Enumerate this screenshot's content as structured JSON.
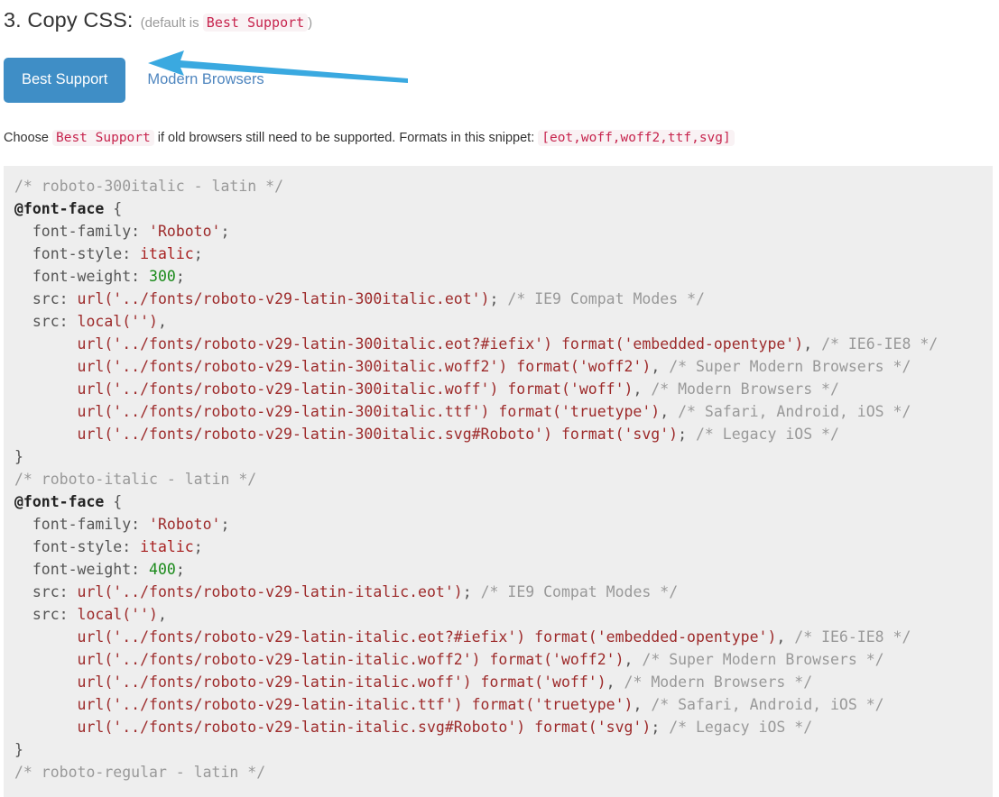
{
  "heading": {
    "title": "3. Copy CSS:",
    "note_prefix": "(default is",
    "note_code": "Best Support",
    "note_suffix": ")"
  },
  "tabs": [
    {
      "label": "Best Support",
      "active": true
    },
    {
      "label": "Modern Browsers",
      "active": false
    }
  ],
  "annotation": {
    "arrow_color": "#3aa9e0",
    "points_to": "Best Support"
  },
  "choose_line": {
    "part1": "Choose",
    "code1": "Best Support",
    "part2": "if old browsers still need to be supported. Formats in this snippet:",
    "code2": "[eot,woff,woff2,ttf,svg]"
  },
  "colors": {
    "tab_active_bg": "#3f8ec6",
    "tab_active_text": "#ffffff",
    "tab_inactive_text": "#4f86bf",
    "inline_code_text": "#c7254e",
    "inline_code_bg": "#f9f2f4",
    "code_block_bg": "#eeeeee",
    "comment": "#999999",
    "string": "#9d2a2a",
    "number": "#1a8a1a"
  },
  "code": {
    "language": "css",
    "lines": [
      [
        [
          "cm",
          "/* roboto-300italic - latin */"
        ]
      ],
      [
        [
          "at",
          "@font-face"
        ],
        [
          "pn",
          " {"
        ]
      ],
      [
        [
          "pr",
          "  font-family: "
        ],
        [
          "st",
          "'Roboto'"
        ],
        [
          "pn",
          ";"
        ]
      ],
      [
        [
          "pr",
          "  font-style: "
        ],
        [
          "kw",
          "italic"
        ],
        [
          "pn",
          ";"
        ]
      ],
      [
        [
          "pr",
          "  font-weight: "
        ],
        [
          "nm",
          "300"
        ],
        [
          "pn",
          ";"
        ]
      ],
      [
        [
          "pr",
          "  src: "
        ],
        [
          "st",
          "url('../fonts/roboto-v29-latin-300italic.eot')"
        ],
        [
          "pn",
          "; "
        ],
        [
          "cm",
          "/* IE9 Compat Modes */"
        ]
      ],
      [
        [
          "pr",
          "  src: "
        ],
        [
          "st",
          "local('')"
        ],
        [
          "pn",
          ","
        ]
      ],
      [
        [
          "st",
          "       url('../fonts/roboto-v29-latin-300italic.eot?#iefix') format('embedded-opentype')"
        ],
        [
          "pn",
          ", "
        ],
        [
          "cm",
          "/* IE6-IE8 */"
        ]
      ],
      [
        [
          "st",
          "       url('../fonts/roboto-v29-latin-300italic.woff2') format('woff2')"
        ],
        [
          "pn",
          ", "
        ],
        [
          "cm",
          "/* Super Modern Browsers */"
        ]
      ],
      [
        [
          "st",
          "       url('../fonts/roboto-v29-latin-300italic.woff') format('woff')"
        ],
        [
          "pn",
          ", "
        ],
        [
          "cm",
          "/* Modern Browsers */"
        ]
      ],
      [
        [
          "st",
          "       url('../fonts/roboto-v29-latin-300italic.ttf') format('truetype')"
        ],
        [
          "pn",
          ", "
        ],
        [
          "cm",
          "/* Safari, Android, iOS */"
        ]
      ],
      [
        [
          "st",
          "       url('../fonts/roboto-v29-latin-300italic.svg#Roboto') format('svg')"
        ],
        [
          "pn",
          "; "
        ],
        [
          "cm",
          "/* Legacy iOS */"
        ]
      ],
      [
        [
          "pn",
          "}"
        ]
      ],
      [
        [
          "cm",
          "/* roboto-italic - latin */"
        ]
      ],
      [
        [
          "at",
          "@font-face"
        ],
        [
          "pn",
          " {"
        ]
      ],
      [
        [
          "pr",
          "  font-family: "
        ],
        [
          "st",
          "'Roboto'"
        ],
        [
          "pn",
          ";"
        ]
      ],
      [
        [
          "pr",
          "  font-style: "
        ],
        [
          "kw",
          "italic"
        ],
        [
          "pn",
          ";"
        ]
      ],
      [
        [
          "pr",
          "  font-weight: "
        ],
        [
          "nm",
          "400"
        ],
        [
          "pn",
          ";"
        ]
      ],
      [
        [
          "pr",
          "  src: "
        ],
        [
          "st",
          "url('../fonts/roboto-v29-latin-italic.eot')"
        ],
        [
          "pn",
          "; "
        ],
        [
          "cm",
          "/* IE9 Compat Modes */"
        ]
      ],
      [
        [
          "pr",
          "  src: "
        ],
        [
          "st",
          "local('')"
        ],
        [
          "pn",
          ","
        ]
      ],
      [
        [
          "st",
          "       url('../fonts/roboto-v29-latin-italic.eot?#iefix') format('embedded-opentype')"
        ],
        [
          "pn",
          ", "
        ],
        [
          "cm",
          "/* IE6-IE8 */"
        ]
      ],
      [
        [
          "st",
          "       url('../fonts/roboto-v29-latin-italic.woff2') format('woff2')"
        ],
        [
          "pn",
          ", "
        ],
        [
          "cm",
          "/* Super Modern Browsers */"
        ]
      ],
      [
        [
          "st",
          "       url('../fonts/roboto-v29-latin-italic.woff') format('woff')"
        ],
        [
          "pn",
          ", "
        ],
        [
          "cm",
          "/* Modern Browsers */"
        ]
      ],
      [
        [
          "st",
          "       url('../fonts/roboto-v29-latin-italic.ttf') format('truetype')"
        ],
        [
          "pn",
          ", "
        ],
        [
          "cm",
          "/* Safari, Android, iOS */"
        ]
      ],
      [
        [
          "st",
          "       url('../fonts/roboto-v29-latin-italic.svg#Roboto') format('svg')"
        ],
        [
          "pn",
          "; "
        ],
        [
          "cm",
          "/* Legacy iOS */"
        ]
      ],
      [
        [
          "pn",
          "}"
        ]
      ],
      [
        [
          "cm",
          "/* roboto-regular - latin */"
        ]
      ]
    ]
  }
}
